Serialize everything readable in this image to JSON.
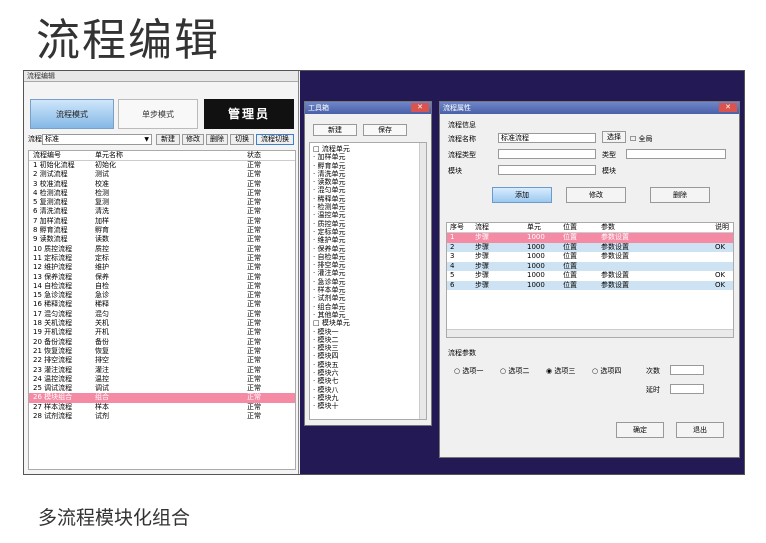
{
  "heading": "流程编辑",
  "caption": "多流程模块化组合",
  "left_window": {
    "title": "流程编辑",
    "tabs": [
      "流程模式",
      "单步模式",
      "管理员"
    ],
    "toolbar": {
      "label": "流程",
      "select_value": "标准",
      "buttons": [
        "新建",
        "修改",
        "删除",
        "切换",
        "流程切换"
      ]
    },
    "list_headers": [
      "流程编号",
      "单元名称",
      "状态"
    ],
    "rows": [
      [
        "1 初始化流程",
        "初始化",
        "正常"
      ],
      [
        "2 测试流程",
        "测试",
        "正常"
      ],
      [
        "3 校准流程",
        "校准",
        "正常"
      ],
      [
        "4 检测流程",
        "检测",
        "正常"
      ],
      [
        "5 复测流程",
        "复测",
        "正常"
      ],
      [
        "6 清洗流程",
        "清洗",
        "正常"
      ],
      [
        "7 加样流程",
        "加样",
        "正常"
      ],
      [
        "8 孵育流程",
        "孵育",
        "正常"
      ],
      [
        "9 读数流程",
        "读数",
        "正常"
      ],
      [
        "10 质控流程",
        "质控",
        "正常"
      ],
      [
        "11 定标流程",
        "定标",
        "正常"
      ],
      [
        "12 维护流程",
        "维护",
        "正常"
      ],
      [
        "13 保养流程",
        "保养",
        "正常"
      ],
      [
        "14 自检流程",
        "自检",
        "正常"
      ],
      [
        "15 急诊流程",
        "急诊",
        "正常"
      ],
      [
        "16 稀释流程",
        "稀释",
        "正常"
      ],
      [
        "17 混匀流程",
        "混匀",
        "正常"
      ],
      [
        "18 关机流程",
        "关机",
        "正常"
      ],
      [
        "19 开机流程",
        "开机",
        "正常"
      ],
      [
        "20 备份流程",
        "备份",
        "正常"
      ],
      [
        "21 恢复流程",
        "恢复",
        "正常"
      ],
      [
        "22 排空流程",
        "排空",
        "正常"
      ],
      [
        "23 灌注流程",
        "灌注",
        "正常"
      ],
      [
        "24 温控流程",
        "温控",
        "正常"
      ],
      [
        "25 调试流程",
        "调试",
        "正常"
      ],
      [
        "26 模块组合",
        "组合",
        "正常"
      ],
      [
        "27 样本流程",
        "样本",
        "正常"
      ],
      [
        "28 试剂流程",
        "试剂",
        "正常"
      ]
    ],
    "selected_row": 25
  },
  "tool_window": {
    "title": "工具箱",
    "buttons": [
      "新建",
      "保存"
    ],
    "tree": [
      "□ 流程单元",
      "  · 加样单元",
      "  · 孵育单元",
      "  · 清洗单元",
      "  · 读数单元",
      "  · 混匀单元",
      "  · 稀释单元",
      "  · 检测单元",
      "  · 温控单元",
      "  · 质控单元",
      "  · 定标单元",
      "  · 维护单元",
      "  · 保养单元",
      "  · 自检单元",
      "  · 排空单元",
      "  · 灌注单元",
      "  · 急诊单元",
      "  · 样本单元",
      "  · 试剂单元",
      "  · 组合单元",
      "  · 其他单元",
      "□ 模块单元",
      "  · 模块一",
      "  · 模块二",
      "  · 模块三",
      "  · 模块四",
      "  · 模块五",
      "  · 模块六",
      "  · 模块七",
      "  · 模块八",
      "  · 模块九",
      "  · 模块十"
    ]
  },
  "prop_window": {
    "title": "流程属性",
    "section_label": "流程信息",
    "name_label": "流程名称",
    "name_value": "标准流程",
    "name_btn": "选择",
    "check_label": "全局",
    "type_label": "流程类型",
    "type_value": "",
    "type_extra_label": "类型",
    "type_extra_value": "",
    "module_label": "模块",
    "module_value": "",
    "module_extra_label": "模块",
    "buttons": [
      "添加",
      "修改",
      "删除"
    ],
    "grid_headers": [
      "序号",
      "流程",
      "单元",
      "位置",
      "参数",
      "说明"
    ],
    "grid_rows": [
      [
        "1",
        "步骤",
        "1000",
        "位置",
        "参数设置",
        ""
      ],
      [
        "2",
        "步骤",
        "1000",
        "位置",
        "参数设置",
        "OK"
      ],
      [
        "3",
        "步骤",
        "1000",
        "位置",
        "参数设置",
        ""
      ],
      [
        "4",
        "步骤",
        "1000",
        "位置",
        "",
        ""
      ],
      [
        "5",
        "步骤",
        "1000",
        "位置",
        "参数设置",
        "OK"
      ],
      [
        "6",
        "步骤",
        "1000",
        "位置",
        "参数设置",
        "OK"
      ]
    ],
    "options_label": "流程参数",
    "radios": [
      "选项一",
      "选项二",
      "选项三",
      "选项四"
    ],
    "count_label": "次数",
    "delay_label": "延时",
    "ok": "确定",
    "exit": "退出"
  }
}
